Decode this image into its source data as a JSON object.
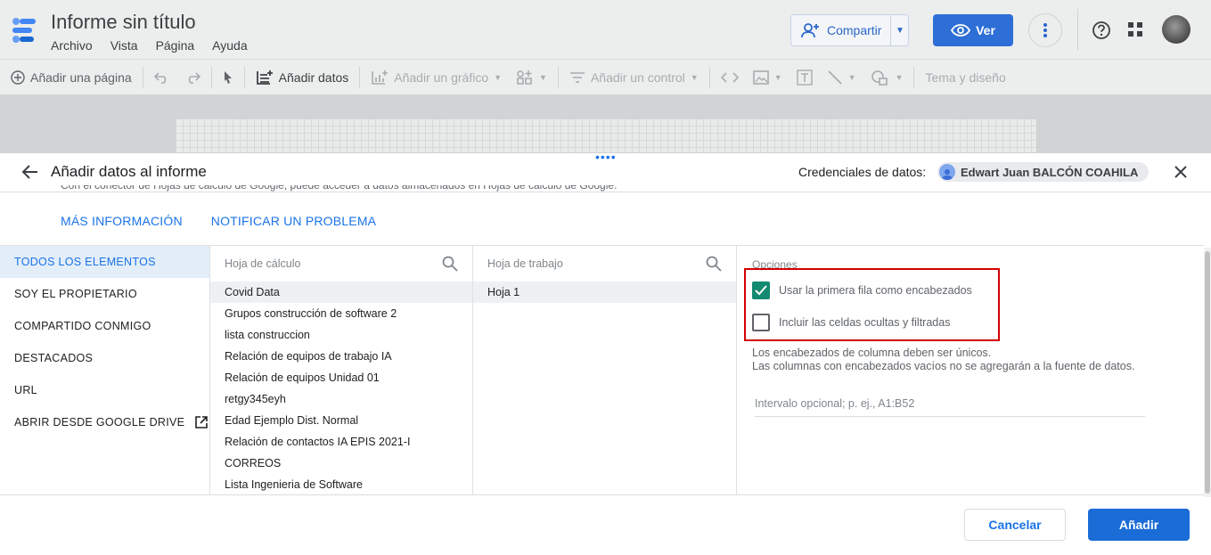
{
  "app": {
    "doc_title": "Informe sin título",
    "menu": [
      "Archivo",
      "Vista",
      "Página",
      "Ayuda"
    ],
    "share_label": "Compartir",
    "view_label": "Ver",
    "accent": "#1a73e8"
  },
  "toolbar": {
    "add_page": "Añadir una página",
    "add_data": "Añadir datos",
    "add_chart": "Añadir un gráfico",
    "add_control": "Añadir un control",
    "theme": "Tema y diseño"
  },
  "panel": {
    "title": "Añadir datos al informe",
    "cred_label": "Credenciales de datos:",
    "cred_user": "Edwart Juan BALCÓN COAHILA",
    "cut_text": "Con el conector de Hojas de cálculo de Google, puede acceder a datos almacenados en Hojas de cálculo de Google.",
    "link_more": "MÁS INFORMACIÓN",
    "link_report": "NOTIFICAR UN PROBLEMA"
  },
  "sidebar": {
    "items": [
      {
        "label": "TODOS LOS ELEMENTOS"
      },
      {
        "label": "SOY EL PROPIETARIO"
      },
      {
        "label": "COMPARTIDO CONMIGO"
      },
      {
        "label": "DESTACADOS"
      },
      {
        "label": "URL"
      },
      {
        "label": "ABRIR DESDE GOOGLE DRIVE"
      }
    ]
  },
  "spreadsheets": {
    "header": "Hoja de cálculo",
    "items": [
      "Covid Data",
      "Grupos construcción de software 2",
      "lista construccion",
      "Relación de equipos de trabajo IA",
      "Relación de equipos Unidad 01",
      "retgy345eyh",
      "Edad Ejemplo Dist. Normal",
      "Relación de contactos IA EPIS 2021-I",
      "CORREOS",
      "Lista Ingenieria de Software"
    ]
  },
  "worksheets": {
    "header": "Hoja de trabajo",
    "items": [
      "Hoja 1"
    ]
  },
  "options": {
    "title": "Opciones",
    "opt1": "Usar la primera fila como encabezados",
    "opt2": "Incluir las celdas ocultas y filtradas",
    "note1": "Los encabezados de columna deben ser únicos.",
    "note2": "Las columnas con encabezados vacíos no se agregarán a la fuente de datos.",
    "range_placeholder": "Intervalo opcional; p. ej., A1:B52"
  },
  "footer": {
    "cancel": "Cancelar",
    "add": "Añadir"
  }
}
